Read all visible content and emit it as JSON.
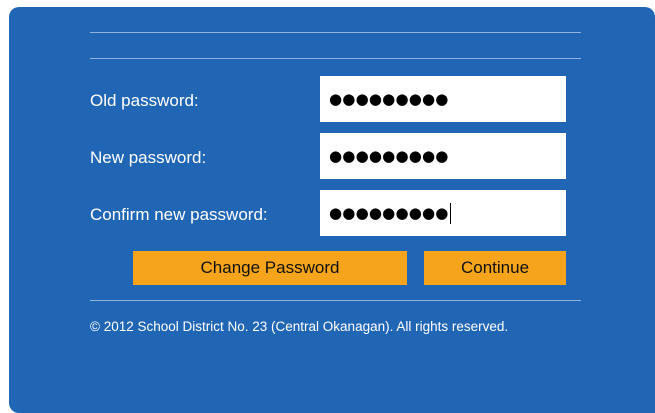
{
  "form": {
    "old_password_label": "Old password:",
    "old_password_value": "●●●●●●●●●",
    "new_password_label": "New password:",
    "new_password_value": "●●●●●●●●●",
    "confirm_password_label": "Confirm new password:",
    "confirm_password_value": "●●●●●●●●●"
  },
  "buttons": {
    "change_password": "Change Password",
    "continue": "Continue"
  },
  "footer": {
    "copyright": "© 2012 School District No. 23 (Central Okanagan). All rights reserved."
  },
  "colors": {
    "panel_bg": "#2166b5",
    "button_bg": "#f6a41b",
    "divider": "#8fb3de"
  }
}
